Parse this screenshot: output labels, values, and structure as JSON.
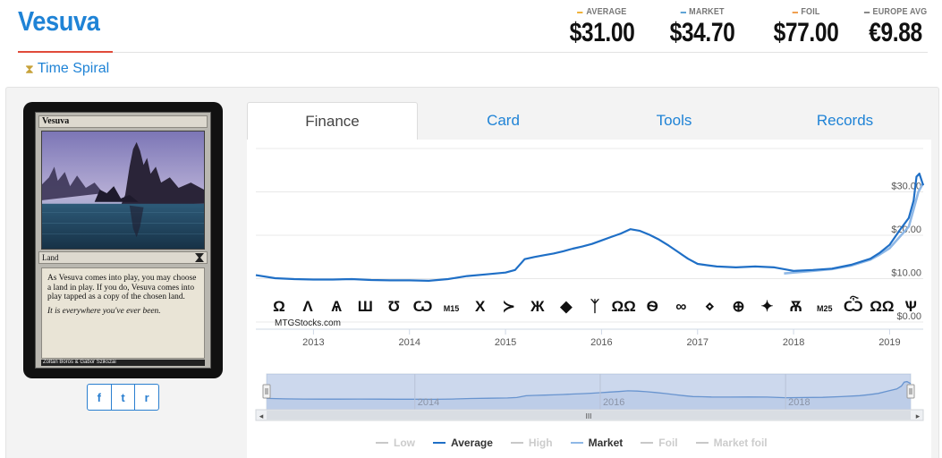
{
  "card": {
    "name": "Vesuva",
    "set_name": "Time Spiral"
  },
  "prices": [
    {
      "label": "AVERAGE",
      "value": "$31.00",
      "color": "#f0b23a"
    },
    {
      "label": "MARKET",
      "value": "$34.70",
      "color": "#5fa4d6"
    },
    {
      "label": "FOIL",
      "value": "$77.00",
      "color": "#f0a050"
    },
    {
      "label": "EUROPE AVG",
      "value": "€9.88",
      "color": "#888888"
    }
  ],
  "card_image": {
    "name_line": "Vesuva",
    "type_line": "Land",
    "rules_text": "As Vesuva comes into play, you may choose a land in play. If you do, Vesuva comes into play tapped as a copy of the chosen land.",
    "flavor_text": "It is everywhere you've ever been.",
    "artist": "Zoltan Boros & Gabor Szikszai"
  },
  "share": {
    "facebook": "f",
    "twitter": "t",
    "reddit": "r"
  },
  "tabs": [
    "Finance",
    "Card",
    "Tools",
    "Records"
  ],
  "active_tab": "Finance",
  "chart": {
    "watermark": "MTGStocks.com",
    "scrollbar_handle": "III",
    "set_symbols": [
      "Ω",
      "Ʌ",
      "Ѧ",
      "Ш",
      "Ʊ",
      "Ѡ",
      "M15",
      "X",
      "≻",
      "Ж",
      "◆",
      "ᛉ",
      "ΩΩ",
      "Ѳ",
      "∞",
      "⋄",
      "⊕",
      "✦",
      "Ѫ",
      "M25",
      "Ѽ",
      "ΩΩ",
      "Ѱ"
    ]
  },
  "chart_data": {
    "type": "line",
    "x_ticks": [
      "2013",
      "2014",
      "2015",
      "2016",
      "2017",
      "2018",
      "2019"
    ],
    "y_ticks": [
      "$0.00",
      "$10.00",
      "$20.00",
      "$30.00"
    ],
    "ylim": [
      0,
      40
    ],
    "xlim": [
      2012.4,
      2019.35
    ],
    "navigator_labels": [
      "2014",
      "2016",
      "2018"
    ],
    "series": [
      {
        "name": "Average",
        "color": "#1f6fc6",
        "points": [
          [
            2012.4,
            10.8
          ],
          [
            2012.6,
            10.1
          ],
          [
            2012.8,
            9.9
          ],
          [
            2013.0,
            9.8
          ],
          [
            2013.2,
            9.8
          ],
          [
            2013.4,
            9.9
          ],
          [
            2013.6,
            9.7
          ],
          [
            2013.8,
            9.6
          ],
          [
            2014.0,
            9.6
          ],
          [
            2014.2,
            9.5
          ],
          [
            2014.4,
            9.9
          ],
          [
            2014.6,
            10.6
          ],
          [
            2014.8,
            11.0
          ],
          [
            2015.0,
            11.4
          ],
          [
            2015.1,
            12.0
          ],
          [
            2015.2,
            14.5
          ],
          [
            2015.3,
            15.0
          ],
          [
            2015.4,
            15.4
          ],
          [
            2015.5,
            15.8
          ],
          [
            2015.6,
            16.3
          ],
          [
            2015.7,
            16.9
          ],
          [
            2015.8,
            17.4
          ],
          [
            2015.9,
            18.0
          ],
          [
            2016.0,
            18.8
          ],
          [
            2016.1,
            19.6
          ],
          [
            2016.2,
            20.4
          ],
          [
            2016.3,
            21.4
          ],
          [
            2016.4,
            21.0
          ],
          [
            2016.5,
            20.1
          ],
          [
            2016.6,
            19.0
          ],
          [
            2016.7,
            17.6
          ],
          [
            2016.8,
            16.1
          ],
          [
            2016.9,
            14.6
          ],
          [
            2017.0,
            13.4
          ],
          [
            2017.1,
            13.1
          ],
          [
            2017.2,
            12.8
          ],
          [
            2017.4,
            12.6
          ],
          [
            2017.6,
            12.8
          ],
          [
            2017.8,
            12.6
          ],
          [
            2018.0,
            11.8
          ],
          [
            2018.2,
            12.0
          ],
          [
            2018.4,
            12.3
          ],
          [
            2018.6,
            13.2
          ],
          [
            2018.8,
            14.6
          ],
          [
            2018.9,
            16.0
          ],
          [
            2019.0,
            17.8
          ],
          [
            2019.1,
            21.0
          ],
          [
            2019.2,
            24.0
          ],
          [
            2019.25,
            28.0
          ],
          [
            2019.28,
            33.5
          ],
          [
            2019.31,
            34.2
          ],
          [
            2019.35,
            31.5
          ]
        ]
      },
      {
        "name": "Market",
        "color": "#8fb8e6",
        "points": [
          [
            2017.9,
            11.2
          ],
          [
            2018.0,
            11.4
          ],
          [
            2018.2,
            11.8
          ],
          [
            2018.4,
            12.2
          ],
          [
            2018.6,
            13.0
          ],
          [
            2018.8,
            14.4
          ],
          [
            2018.9,
            15.6
          ],
          [
            2019.0,
            17.0
          ],
          [
            2019.1,
            19.5
          ],
          [
            2019.2,
            22.0
          ],
          [
            2019.25,
            26.0
          ],
          [
            2019.3,
            30.0
          ],
          [
            2019.35,
            32.0
          ]
        ]
      }
    ],
    "legend": [
      {
        "name": "Low",
        "color": "#c8c8c8",
        "enabled": false
      },
      {
        "name": "Average",
        "color": "#1f6fc6",
        "enabled": true
      },
      {
        "name": "High",
        "color": "#c8c8c8",
        "enabled": false
      },
      {
        "name": "Market",
        "color": "#8fb8e6",
        "enabled": true
      },
      {
        "name": "Foil",
        "color": "#c8c8c8",
        "enabled": false
      },
      {
        "name": "Market foil",
        "color": "#c8c8c8",
        "enabled": false
      }
    ]
  }
}
